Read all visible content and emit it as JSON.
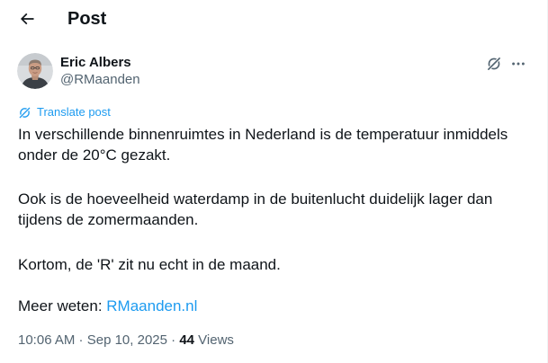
{
  "header": {
    "title": "Post",
    "back_icon": "arrow-left-icon"
  },
  "author": {
    "name": "Eric Albers",
    "handle": "@RMaanden",
    "avatar_icon": "user-avatar-photo"
  },
  "actions": {
    "grok_icon": "grok-icon",
    "more_icon": "more-horizontal-icon"
  },
  "translate": {
    "label": "Translate post",
    "icon": "translate-icon"
  },
  "post": {
    "paragraph1": "In verschillende binnenruimtes in Nederland is de temperatuur inmiddels onder de 20°C gezakt.",
    "paragraph2": "Ook is de hoeveelheid waterdamp in de buitenlucht duidelijk lager dan tijdens de zomermaanden.",
    "paragraph3": "Kortom, de 'R' zit nu echt in de maand.",
    "paragraph4_prefix": "Meer weten: ",
    "link_text": "RMaanden.nl"
  },
  "meta": {
    "time": "10:06 AM",
    "separator1": " · ",
    "date": "Sep 10, 2025",
    "separator2": " · ",
    "views_count": "44",
    "views_label": " Views"
  },
  "colors": {
    "text": "#0f1419",
    "secondary": "#536471",
    "accent": "#1d9bf0"
  }
}
